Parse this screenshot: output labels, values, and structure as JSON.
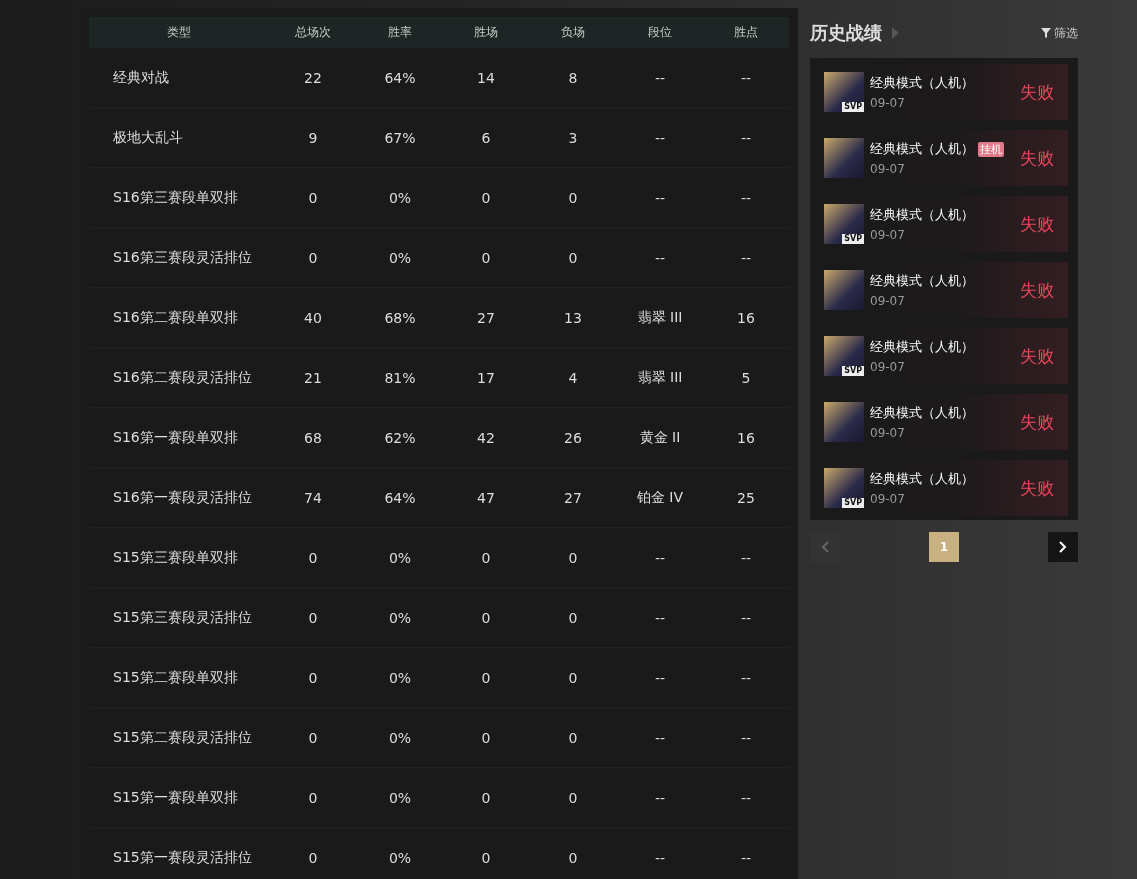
{
  "table": {
    "columns": [
      "类型",
      "总场次",
      "胜率",
      "胜场",
      "负场",
      "段位",
      "胜点"
    ],
    "rows": [
      [
        "经典对战",
        "22",
        "64%",
        "14",
        "8",
        "--",
        "--"
      ],
      [
        "极地大乱斗",
        "9",
        "67%",
        "6",
        "3",
        "--",
        "--"
      ],
      [
        "S16第三赛段单双排",
        "0",
        "0%",
        "0",
        "0",
        "--",
        "--"
      ],
      [
        "S16第三赛段灵活排位",
        "0",
        "0%",
        "0",
        "0",
        "--",
        "--"
      ],
      [
        "S16第二赛段单双排",
        "40",
        "68%",
        "27",
        "13",
        "翡翠 III",
        "16"
      ],
      [
        "S16第二赛段灵活排位",
        "21",
        "81%",
        "17",
        "4",
        "翡翠 III",
        "5"
      ],
      [
        "S16第一赛段单双排",
        "68",
        "62%",
        "42",
        "26",
        "黄金 II",
        "16"
      ],
      [
        "S16第一赛段灵活排位",
        "74",
        "64%",
        "47",
        "27",
        "铂金 IV",
        "25"
      ],
      [
        "S15第三赛段单双排",
        "0",
        "0%",
        "0",
        "0",
        "--",
        "--"
      ],
      [
        "S15第三赛段灵活排位",
        "0",
        "0%",
        "0",
        "0",
        "--",
        "--"
      ],
      [
        "S15第二赛段单双排",
        "0",
        "0%",
        "0",
        "0",
        "--",
        "--"
      ],
      [
        "S15第二赛段灵活排位",
        "0",
        "0%",
        "0",
        "0",
        "--",
        "--"
      ],
      [
        "S15第一赛段单双排",
        "0",
        "0%",
        "0",
        "0",
        "--",
        "--"
      ],
      [
        "S15第一赛段灵活排位",
        "0",
        "0%",
        "0",
        "0",
        "--",
        "--"
      ]
    ]
  },
  "history": {
    "title": "历史战绩",
    "filter": "筛选",
    "matches": [
      {
        "mode": "经典模式（人机）",
        "date": "09-07",
        "result": "失败",
        "badge": "SVP"
      },
      {
        "mode": "经典模式（人机）",
        "date": "09-07",
        "result": "失败",
        "tag": "挂机"
      },
      {
        "mode": "经典模式（人机）",
        "date": "09-07",
        "result": "失败",
        "badge": "SVP"
      },
      {
        "mode": "经典模式（人机）",
        "date": "09-07",
        "result": "失败"
      },
      {
        "mode": "经典模式（人机）",
        "date": "09-07",
        "result": "失败",
        "badge": "SVP"
      },
      {
        "mode": "经典模式（人机）",
        "date": "09-07",
        "result": "失败"
      },
      {
        "mode": "经典模式（人机）",
        "date": "09-07",
        "result": "失败",
        "badge": "SVP"
      }
    ],
    "pager": {
      "prev_disabled": true,
      "pages": [
        {
          "label": "1",
          "selected": true
        }
      ],
      "next_disabled": false
    }
  }
}
